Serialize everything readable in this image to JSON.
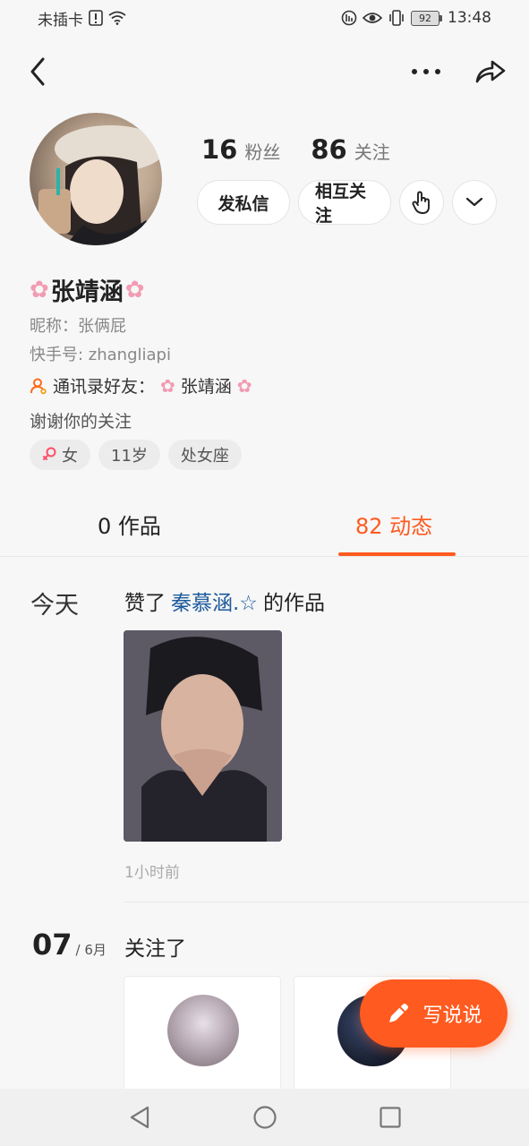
{
  "status_bar": {
    "carrier": "未插卡",
    "battery": "92",
    "time": "13:48"
  },
  "profile": {
    "followers_count": "16",
    "followers_label": "粉丝",
    "following_count": "86",
    "following_label": "关注",
    "message_button": "发私信",
    "mutual_follow_button": "相互关注",
    "display_name": "张靖涵",
    "nickname": "昵称：张俩屁",
    "kuaishou_id": "快手号: zhangliapi",
    "contact_prefix": "通讯录好友：",
    "contact_name": "张靖涵",
    "bio": "谢谢你的关注",
    "tags": [
      "女",
      "11岁",
      "处女座"
    ]
  },
  "tabs": {
    "works": "0 作品",
    "moments": "82 动态"
  },
  "feed": {
    "today_label": "今天",
    "liked_prefix": "赞了",
    "liked_user": "秦慕涵.☆",
    "liked_suffix": "的作品",
    "liked_time": "1小时前",
    "date_day": "07",
    "date_month": "/ 6月",
    "follow_text": "关注了"
  },
  "fab": {
    "label": "写说说"
  },
  "colors": {
    "accent": "#ff5a1f",
    "link": "#1d5a9c",
    "sakura": "#f29bb3"
  }
}
